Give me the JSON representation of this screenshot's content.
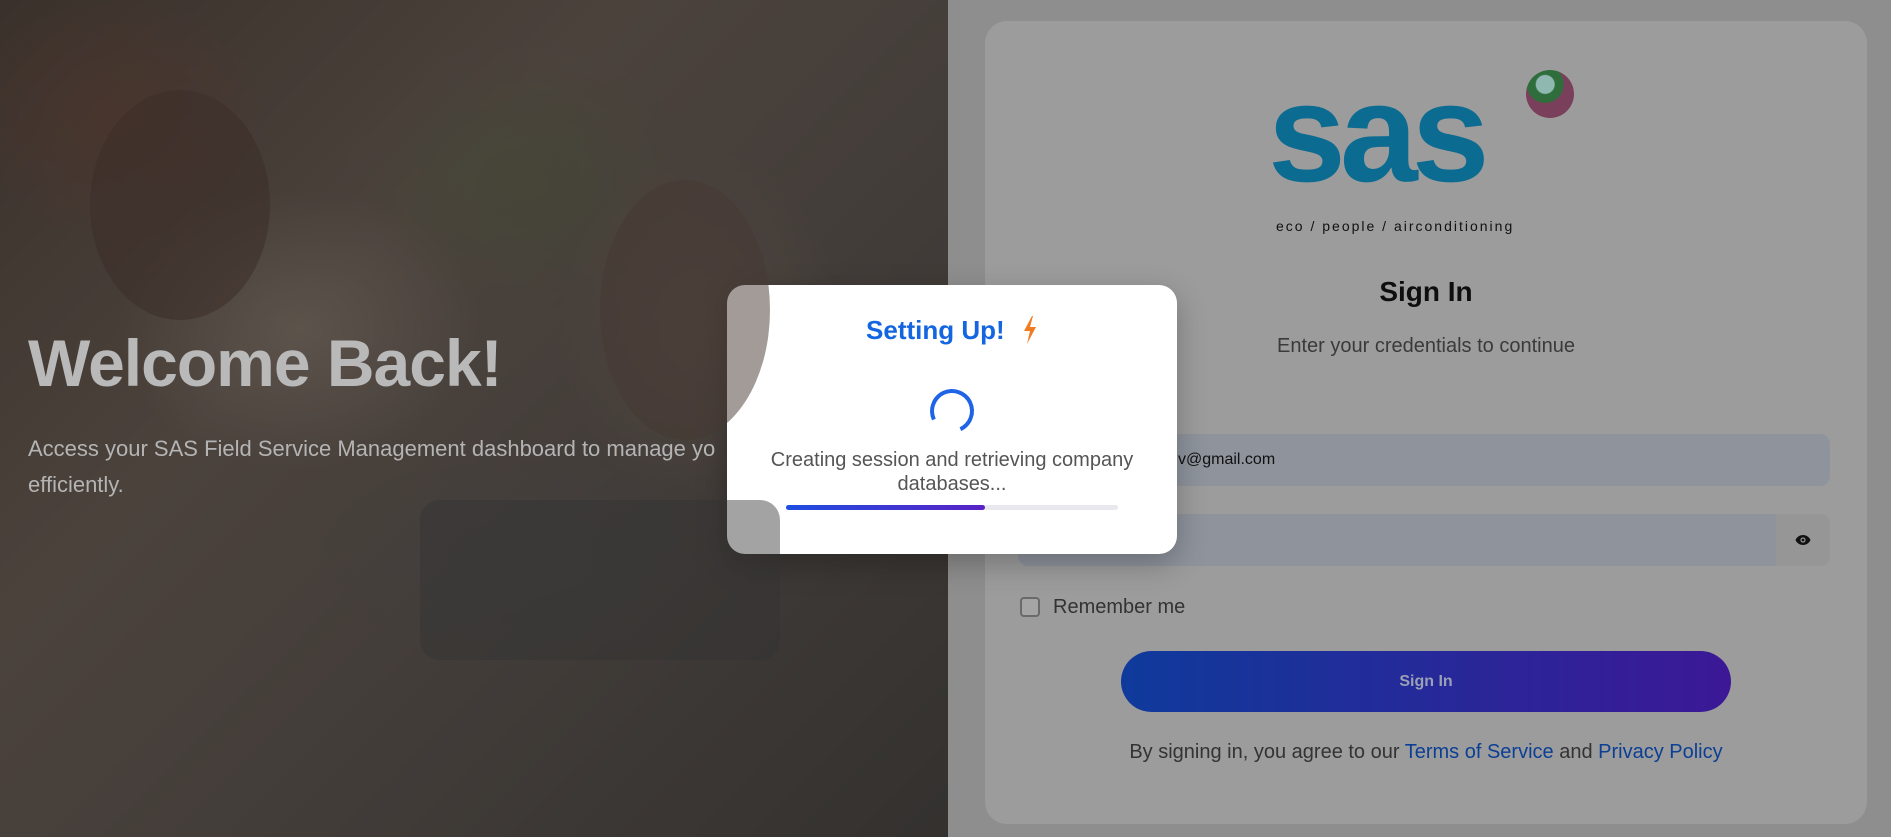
{
  "hero": {
    "title": "Welcome Back!",
    "subtitle": "Access your SAS Field Service Management dashboard to manage yo",
    "subtitle_line2": "efficiently."
  },
  "logo": {
    "text": "sas",
    "tagline": "eco / people / airconditioning"
  },
  "signin": {
    "title": "Sign In",
    "subtitle": "Enter your credentials to continue",
    "email_value": "v@gmail.com",
    "password_value": "",
    "remember_label": "Remember me",
    "button_label": "Sign In",
    "terms_prefix": "By signing in, you agree to our",
    "terms_link": "Terms of Service",
    "terms_and": "and",
    "privacy_link": "Privacy Policy"
  },
  "modal": {
    "title": "Setting Up!",
    "message": "Creating session and retrieving company databases...",
    "progress": 0.6,
    "icon": "bolt-icon"
  },
  "colors": {
    "accent_blue": "#1466e0",
    "bolt_orange": "#f07c22",
    "button_start": "#0f3a9c",
    "button_end": "#3c1896",
    "link": "#0b3f95"
  }
}
